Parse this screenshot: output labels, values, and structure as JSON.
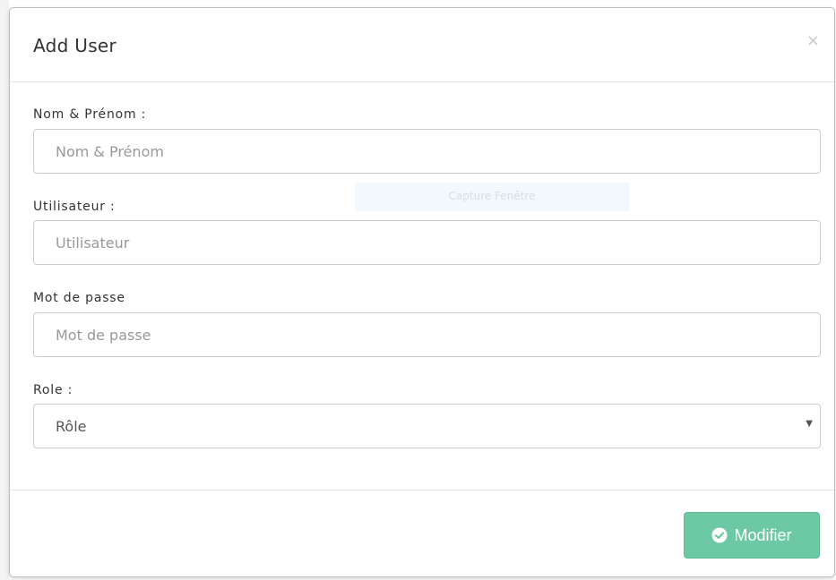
{
  "modal": {
    "title": "Add User",
    "close_glyph": "×"
  },
  "form": {
    "fullname": {
      "label": "Nom & Prénom :",
      "placeholder": "Nom & Prénom",
      "value": ""
    },
    "username": {
      "label": "Utilisateur :",
      "placeholder": "Utilisateur",
      "value": ""
    },
    "password": {
      "label": "Mot de passe",
      "placeholder": "Mot de passe",
      "value": ""
    },
    "role": {
      "label": "Role :",
      "selected": "Rôle",
      "arrow_glyph": "▼"
    }
  },
  "overlay": {
    "text": "Capture Fenêtre"
  },
  "footer": {
    "submit_label": "Modifier",
    "submit_icon": "check-circle-icon",
    "submit_color": "#6dc9a4"
  }
}
